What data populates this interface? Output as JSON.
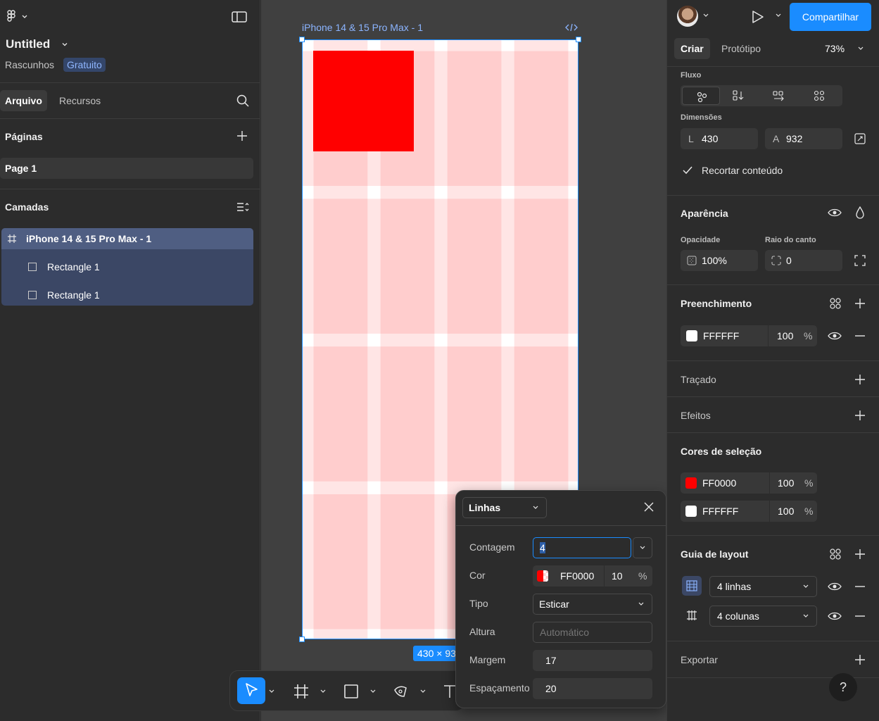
{
  "left_panel": {
    "file_title": "Untitled",
    "project": "Rascunhos",
    "plan_badge": "Gratuito",
    "tabs": [
      "Arquivo",
      "Recursos"
    ],
    "pages_header": "Páginas",
    "pages": [
      "Page 1"
    ],
    "layers_header": "Camadas",
    "layers": [
      {
        "name": "iPhone 14 & 15 Pro Max - 1",
        "type": "frame"
      },
      {
        "name": "Rectangle 1",
        "type": "rectangle"
      },
      {
        "name": "Rectangle 1",
        "type": "rectangle"
      }
    ]
  },
  "canvas": {
    "frame_label": "iPhone 14 & 15 Pro Max - 1",
    "size_badge": "430 × 932",
    "grid": {
      "rows": 4,
      "columns": 4,
      "color": "#FF0000",
      "opacity_pct": 10,
      "margin": 17,
      "gutter": 20
    },
    "rect_color": "#FF0000"
  },
  "grid_popup": {
    "type_select": "Linhas",
    "labels": {
      "count": "Contagem",
      "color": "Cor",
      "type": "Tipo",
      "height": "Altura",
      "margin": "Margem",
      "gutter": "Espaçamento"
    },
    "count_value": "4",
    "color_hex": "FF0000",
    "color_opacity": "10",
    "percent": "%",
    "type_value": "Esticar",
    "height_placeholder": "Automático",
    "margin_value": "17",
    "gutter_value": "20"
  },
  "right_panel": {
    "share_label": "Compartilhar",
    "tabs": [
      "Criar",
      "Protótipo"
    ],
    "zoom": "73%",
    "flow_label": "Fluxo",
    "dimensions_label": "Dimensões",
    "width_prefix": "L",
    "width_value": "430",
    "height_prefix": "A",
    "height_value": "932",
    "clip_content": "Recortar conteúdo",
    "appearance": "Aparência",
    "opacity_label": "Opacidade",
    "opacity_value": "100%",
    "radius_label": "Raio do canto",
    "radius_value": "0",
    "fill_header": "Preenchimento",
    "fill": {
      "hex": "FFFFFF",
      "opacity": "100",
      "pct": "%"
    },
    "stroke_header": "Traçado",
    "effects_header": "Efeitos",
    "selection_colors_header": "Cores de seleção",
    "selection_colors": [
      {
        "hex": "FF0000",
        "opacity": "100",
        "pct": "%"
      },
      {
        "hex": "FFFFFF",
        "opacity": "100",
        "pct": "%"
      }
    ],
    "layout_guide_header": "Guia de layout",
    "layout_guides": [
      "4 linhas",
      "4 colunas"
    ],
    "export_header": "Exportar",
    "help": "?"
  },
  "colors": {
    "accent": "#1a8cff",
    "grid_tint": "#ffd0d0",
    "rect": "#ff0000"
  }
}
